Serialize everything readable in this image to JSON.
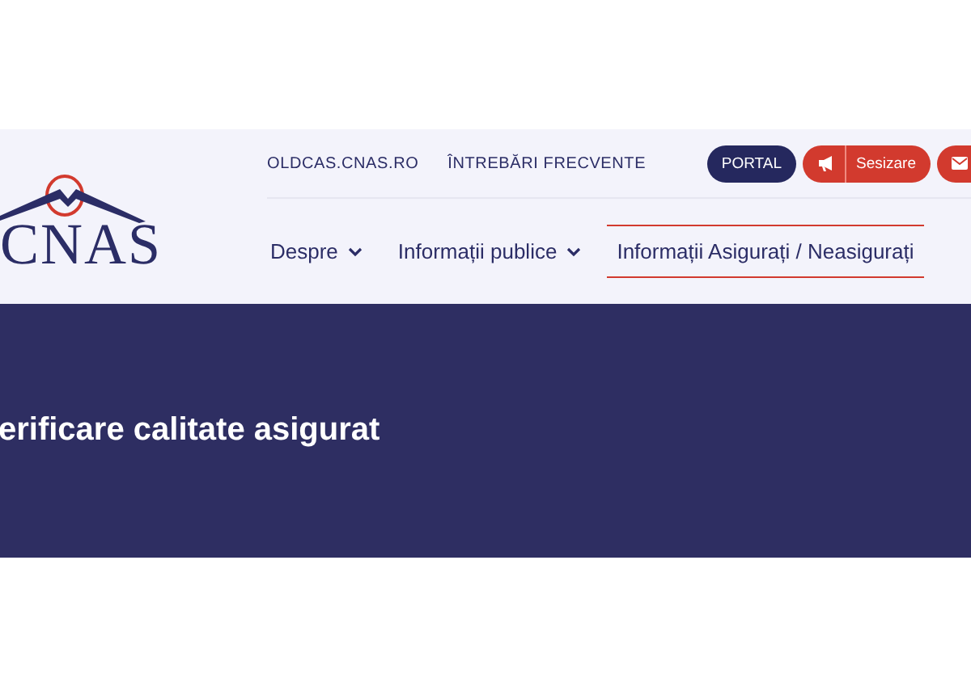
{
  "logo": {
    "text": "CNAS"
  },
  "top_links": [
    "OLDCAS.CNAS.RO",
    "ÎNTREBĂRI FRECVENTE"
  ],
  "actions": [
    {
      "kind": "portal",
      "label": "PORTAL"
    },
    {
      "kind": "report",
      "label": "Sesizare"
    },
    {
      "kind": "mail"
    }
  ],
  "nav": [
    {
      "label": "Despre",
      "has_menu": true,
      "selected": false
    },
    {
      "label": "Informații publice",
      "has_menu": true,
      "selected": false
    },
    {
      "label": "Informații Asigurați / Neasigurați",
      "has_menu": false,
      "selected": true
    }
  ],
  "hero": {
    "title": "erificare calitate asigurat"
  }
}
